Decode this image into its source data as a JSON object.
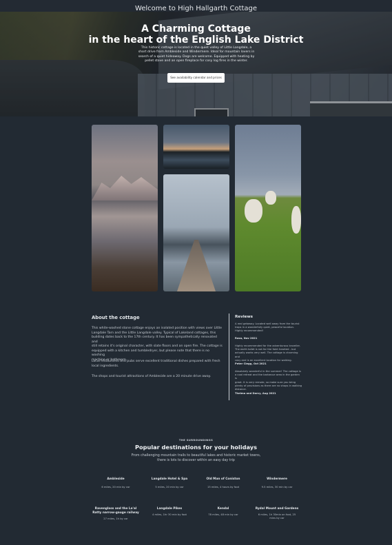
{
  "header": {
    "title": "Welcome to High Hallgarth Cottage"
  },
  "hero": {
    "title_line1": "A Charming Cottage",
    "title_line2": "in the heart of the English Lake District",
    "text_line1": "This historic cottage is located in the quiet valley of Little Langdale, a",
    "text_line2": "short drive from Ambleside and Windermere. Ideal for mountain lovers in",
    "text_line3": "search of a quiet hideaway. Dogs are welcome. Equipped with heating by",
    "text_line4": "pellet stove and an open fireplace for cosy log fires in the winter.",
    "button_label": "See availability calendar and prices"
  },
  "about": {
    "title": "About the cottage",
    "p1_lines": [
      "This white-washed stone cottage enjoys an isolated position with views over Little",
      "Langdale Tarn and the Little Langdale valley. Typical of Lakeland cottages, this",
      "building dates back to the 17th century. It has been sympathetically renovated and",
      "still retains it's original character, with slate floors and an open fire. The cottage is",
      "equipped with a kitchen and tumbledryer, but please note that there is no washing",
      "machine or bathroom."
    ],
    "p2_lines": [
      "Local restaurants and pubs serve excellent traditional dishes prepared with fresh",
      "local ingredients."
    ],
    "p3_lines": [
      "The shops and tourist attractions of Ambleside are a 20 minute drive away."
    ]
  },
  "reviews": {
    "title": "Reviews",
    "items": [
      {
        "lines": [
          "A real getaway. Located well away from the tourist",
          "traps in a wonderfully quiet, peaceful location.",
          "Highly recommended!"
        ],
        "author": "Rosa, Nov 2021"
      },
      {
        "lines": [
          "Highly recommended for the adventurous traveller.",
          "The earth toilet is not for the faint hearted - but",
          "actually works very well. The cottage is charming and",
          "cosy and is an excellent location for walking."
        ],
        "author": "Peter Clegg, Oct 2021"
      },
      {
        "lines": [
          "Absolutely wonderful in the summer! The cottage is",
          "a cool retreat and the barbecue area in the garden is",
          "great. It is very remote, so make sure you bring",
          "plenty of provisions as there are no shops in walking",
          "distance."
        ],
        "author": "Thelma and Darcy, Aug 2021"
      }
    ]
  },
  "surroundings": {
    "kicker": "THE SURROUNDINGS",
    "title": "Popular destinations for your holidays",
    "sub_line1": "From challenging mountain trails to beautiful lakes and historic market towns,",
    "sub_line2": "there is lots to discover within an easy day trip",
    "destinations": [
      {
        "name_lines": [
          "Ambleside"
        ],
        "distance": "6 miles, 20 min by car"
      },
      {
        "name_lines": [
          "Langdale Hotel & Spa"
        ],
        "distance": "5 miles, 20 min by car"
      },
      {
        "name_lines": [
          "Old Man of Coniston"
        ],
        "distance": "15 miles, 4 hours by foot"
      },
      {
        "name_lines": [
          "Windermere"
        ],
        "distance": "9.5 miles, 30 min by car"
      },
      {
        "name_lines": [
          "Ravenglass and the La'al",
          "Ratty narrow-gauge railway"
        ],
        "distance": "27 miles, 1h by car"
      },
      {
        "name_lines": [
          "Langdale Pikes"
        ],
        "distance": "4 miles, 1hr 30 min by foot"
      },
      {
        "name_lines": [
          "Kendal"
        ],
        "distance": "78 miles, 48 min by car"
      },
      {
        "name_lines": [
          "Rydal Mount and Gardens"
        ],
        "distance_lines": [
          "6 miles, 1h 30min on foot, 25",
          "mins by car"
        ]
      }
    ]
  }
}
